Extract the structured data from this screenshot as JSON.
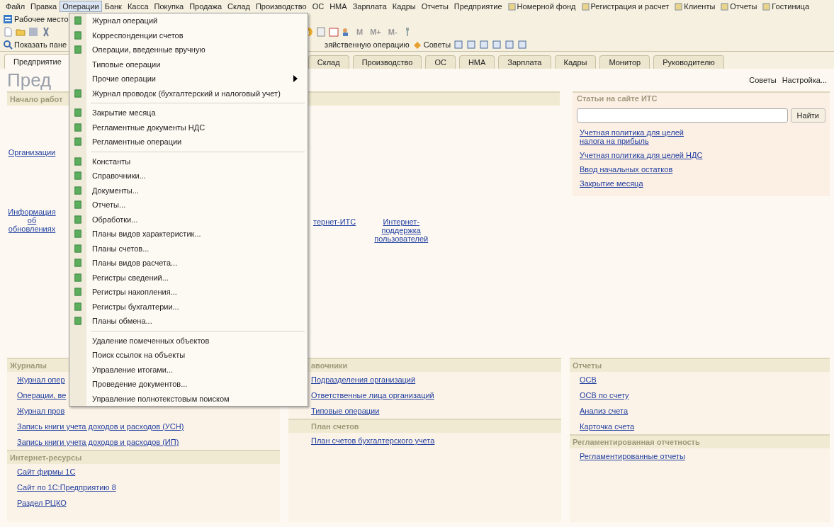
{
  "menubar": [
    {
      "label": "Файл",
      "kind": "text",
      "selected": false
    },
    {
      "label": "Правка",
      "kind": "text",
      "selected": false
    },
    {
      "label": "Операции",
      "kind": "text",
      "selected": true
    },
    {
      "label": "Банк",
      "kind": "text",
      "selected": false
    },
    {
      "label": "Касса",
      "kind": "text",
      "selected": false
    },
    {
      "label": "Покупка",
      "kind": "text",
      "selected": false
    },
    {
      "label": "Продажа",
      "kind": "text",
      "selected": false
    },
    {
      "label": "Склад",
      "kind": "text",
      "selected": false
    },
    {
      "label": "Производство",
      "kind": "text",
      "selected": false
    },
    {
      "label": "ОС",
      "kind": "text",
      "selected": false
    },
    {
      "label": "НМА",
      "kind": "text",
      "selected": false
    },
    {
      "label": "Зарплата",
      "kind": "text",
      "selected": false
    },
    {
      "label": "Кадры",
      "kind": "text",
      "selected": false
    },
    {
      "label": "Отчеты",
      "kind": "text",
      "selected": false
    },
    {
      "label": "Предприятие",
      "kind": "text",
      "selected": false
    },
    {
      "label": "Номерной фонд",
      "kind": "icon",
      "selected": false
    },
    {
      "label": "Регистрация и расчет",
      "kind": "icon",
      "selected": false
    },
    {
      "label": "Клиенты",
      "kind": "icon",
      "selected": false
    },
    {
      "label": "Отчеты",
      "kind": "icon",
      "selected": false
    },
    {
      "label": "Гостиница",
      "kind": "icon",
      "selected": false
    }
  ],
  "toolbar": {
    "workplace_button": "Рабочее место",
    "memory_buttons": [
      "M",
      "M+",
      "M-"
    ],
    "show_panel_button": "Показать пане",
    "operation_button": "зяйственную операцию",
    "tips_button": "Советы"
  },
  "tabs": [
    {
      "label": "Предприятие",
      "selected": true
    },
    {
      "label": "Склад",
      "selected": false
    },
    {
      "label": "Производство",
      "selected": false
    },
    {
      "label": "ОС",
      "selected": false
    },
    {
      "label": "НМА",
      "selected": false
    },
    {
      "label": "Зарплата",
      "selected": false
    },
    {
      "label": "Кадры",
      "selected": false
    },
    {
      "label": "Монитор",
      "selected": false
    },
    {
      "label": "Руководителю",
      "selected": false
    }
  ],
  "header": {
    "title": "Пред",
    "tips": "Советы",
    "settings": "Настройка..."
  },
  "start": {
    "title": "Начало работ",
    "left_items": [
      "Организации",
      "Информация об обновлениях"
    ],
    "right_items": [
      "тернет-ИТС",
      "Интернет-поддержка пользователей"
    ]
  },
  "its_panel": {
    "title": "Статьи на сайте ИТС",
    "search_button": "Найти",
    "links": [
      "Учетная политика для целей налога на прибыль",
      "Учетная политика для целей НДС",
      "Ввод начальных остатков",
      "Закрытие месяца"
    ]
  },
  "journals": {
    "title": "Журналы",
    "items": [
      "Журнал опер",
      "Операции, ве",
      "Журнал пров",
      "Запись книги учета доходов и расходов (УСН)",
      "Запись книги учета доходов и расходов (ИП)"
    ]
  },
  "internet": {
    "title": "Интернет-ресурсы",
    "items": [
      "Сайт фирмы 1С",
      "Сайт по 1С:Предприятию 8",
      "Раздел РЦКО"
    ]
  },
  "catalogs": {
    "title": "авочники",
    "items": [
      "Подразделения организаций",
      "Ответственные лица организаций",
      "Типовые операции"
    ]
  },
  "accounts": {
    "title": "План счетов",
    "items": [
      "План счетов бухгалтерского учета"
    ]
  },
  "reports": {
    "title": "Отчеты",
    "items": [
      "ОСВ",
      "ОСВ по счету",
      "Анализ счета",
      "Карточка счета"
    ]
  },
  "regulated": {
    "title": "Регламентированная отчетность",
    "items": [
      "Регламентированные отчеты"
    ]
  },
  "menu": [
    {
      "kind": "icon_item",
      "label": "Журнал операций"
    },
    {
      "kind": "icon_item",
      "label": "Корреспонденции счетов"
    },
    {
      "kind": "icon_item",
      "label": "Операции, введенные вручную"
    },
    {
      "kind": "item",
      "label": "Типовые операции"
    },
    {
      "kind": "submenu",
      "label": "Прочие операции"
    },
    {
      "kind": "icon_item",
      "label": "Журнал проводок (бухгалтерский и налоговый учет)"
    },
    {
      "kind": "separator"
    },
    {
      "kind": "icon_item",
      "label": "Закрытие месяца"
    },
    {
      "kind": "icon_item",
      "label": "Регламентные документы НДС"
    },
    {
      "kind": "icon_item",
      "label": "Регламентные операции"
    },
    {
      "kind": "separator"
    },
    {
      "kind": "icon_item",
      "label": "Константы"
    },
    {
      "kind": "icon_item",
      "label": "Справочники..."
    },
    {
      "kind": "icon_item",
      "label": "Документы..."
    },
    {
      "kind": "icon_item",
      "label": "Отчеты..."
    },
    {
      "kind": "icon_item",
      "label": "Обработки..."
    },
    {
      "kind": "icon_item",
      "label": "Планы видов характеристик..."
    },
    {
      "kind": "icon_item",
      "label": "Планы счетов..."
    },
    {
      "kind": "icon_item",
      "label": "Планы видов расчета..."
    },
    {
      "kind": "icon_item",
      "label": "Регистры сведений..."
    },
    {
      "kind": "icon_item",
      "label": "Регистры накопления..."
    },
    {
      "kind": "icon_item",
      "label": "Регистры бухгалтерии..."
    },
    {
      "kind": "icon_item",
      "label": "Планы обмена..."
    },
    {
      "kind": "separator"
    },
    {
      "kind": "item",
      "label": "Удаление помеченных объектов"
    },
    {
      "kind": "item",
      "label": "Поиск ссылок на объекты"
    },
    {
      "kind": "item",
      "label": "Управление итогами..."
    },
    {
      "kind": "item",
      "label": "Проведение документов..."
    },
    {
      "kind": "item",
      "label": "Управление полнотекстовым поиском"
    }
  ]
}
